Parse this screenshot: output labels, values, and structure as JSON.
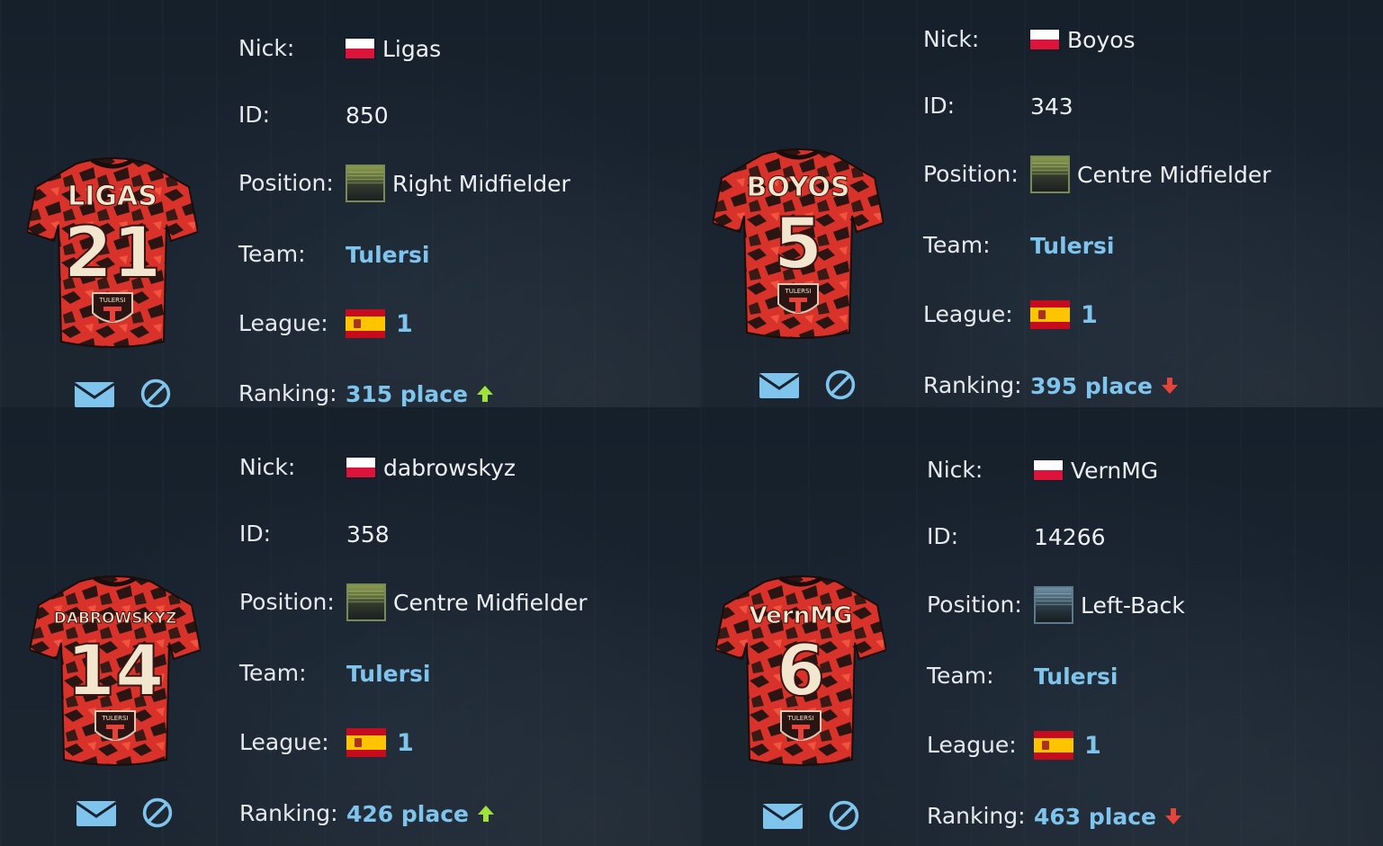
{
  "labels": {
    "nick": "Nick:",
    "id": "ID:",
    "position": "Position:",
    "team": "Team:",
    "league": "League:",
    "ranking": "Ranking:"
  },
  "colors": {
    "link": "#7fc4ec",
    "arrow_up": "#9fe23a",
    "arrow_down": "#e8433a",
    "jersey_red": "#d8322a",
    "jersey_dark": "#2a1512"
  },
  "icons": {
    "message": "envelope-icon",
    "block": "block-icon"
  },
  "players": [
    {
      "nick": "Ligas",
      "nick_flag": "poland-flag-icon",
      "id": "850",
      "position": "Right Midfielder",
      "position_icon": "midfield-zone-icon",
      "team": "Tulersi",
      "league_flag": "spain-flag-icon",
      "league": "1",
      "ranking": "315 place",
      "ranking_trend": "up",
      "jersey_name": "LIGAS",
      "jersey_number": "21",
      "jersey_crest": "TULERSI"
    },
    {
      "nick": "Boyos",
      "nick_flag": "poland-flag-icon",
      "id": "343",
      "position": "Centre Midfielder",
      "position_icon": "midfield-zone-icon",
      "team": "Tulersi",
      "league_flag": "spain-flag-icon",
      "league": "1",
      "ranking": "395 place",
      "ranking_trend": "down",
      "jersey_name": "BOYOS",
      "jersey_number": "5",
      "jersey_crest": "TULERSI"
    },
    {
      "nick": "dabrowskyz",
      "nick_flag": "poland-flag-icon",
      "id": "358",
      "position": "Centre Midfielder",
      "position_icon": "midfield-zone-icon",
      "team": "Tulersi",
      "league_flag": "spain-flag-icon",
      "league": "1",
      "ranking": "426 place",
      "ranking_trend": "up",
      "jersey_name": "DABROWSKYZ",
      "jersey_number": "14",
      "jersey_crest": "TULERSI"
    },
    {
      "nick": "VernMG",
      "nick_flag": "poland-flag-icon",
      "id": "14266",
      "position": "Left-Back",
      "position_icon": "defence-zone-icon",
      "team": "Tulersi",
      "league_flag": "spain-flag-icon",
      "league": "1",
      "ranking": "463 place",
      "ranking_trend": "down",
      "jersey_name": "VernMG",
      "jersey_number": "6",
      "jersey_crest": "TULERSI"
    }
  ]
}
